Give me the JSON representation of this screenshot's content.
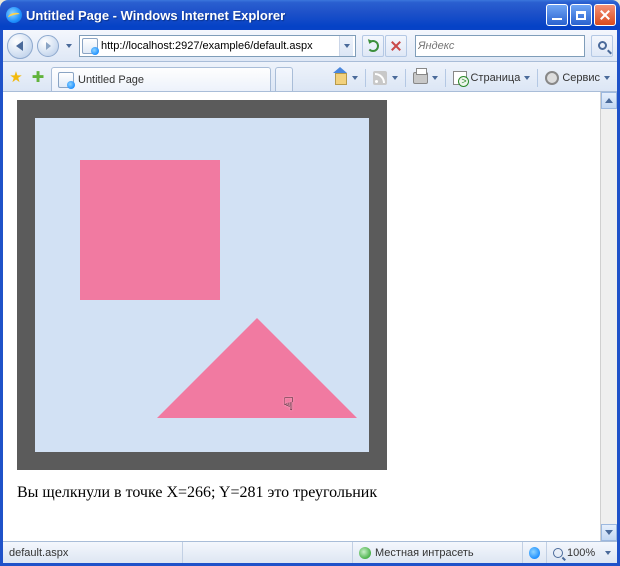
{
  "window": {
    "title": "Untitled Page - Windows Internet Explorer"
  },
  "address": {
    "url": "http://localhost:2927/example6/default.aspx"
  },
  "search": {
    "placeholder": "Яндекс"
  },
  "tab": {
    "title": "Untitled Page"
  },
  "toolbar": {
    "page_label": "Страница",
    "service_label": "Сервис"
  },
  "content": {
    "message": "Вы щелкнули в точке X=266; Y=281 это треугольник"
  },
  "status": {
    "file": "default.aspx",
    "zone": "Местная интрасеть",
    "zoom": "100%"
  }
}
